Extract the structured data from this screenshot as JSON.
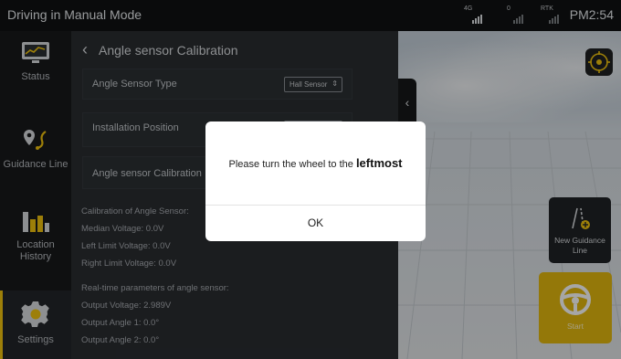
{
  "topbar": {
    "title": "Driving in Manual Mode",
    "signals": [
      {
        "label": "4G"
      },
      {
        "label": "0"
      },
      {
        "label": "RTK"
      }
    ],
    "clock": "PM2:54"
  },
  "sidebar": {
    "items": [
      {
        "label": "Status",
        "icon": "monitor-chart-icon",
        "active": false
      },
      {
        "label": "Guidance Line",
        "icon": "guidance-line-icon",
        "active": false
      },
      {
        "label": "Location History",
        "icon": "bar-chart-icon",
        "active": false
      },
      {
        "label": "Settings",
        "icon": "gear-icon",
        "active": true
      }
    ]
  },
  "panel": {
    "header": "Angle sensor Calibration",
    "rows": [
      {
        "label": "Angle Sensor Type",
        "value": "Hall Sensor"
      },
      {
        "label": "Installation Position",
        "value": ""
      },
      {
        "label": "Angle sensor Calibration",
        "value": ""
      }
    ],
    "calibration": {
      "heading": "Calibration of Angle Sensor:",
      "median": "Median Voltage: 0.0V",
      "left": "Left Limit Voltage: 0.0V",
      "right": "Right Limit Voltage: 0.0V"
    },
    "realtime": {
      "heading": "Real-time parameters of angle sensor:",
      "output_voltage": "Output Voltage: 2.989V",
      "angle1": "Output Angle 1: 0.0°",
      "angle2": "Output Angle 2: 0.0°"
    }
  },
  "map": {
    "new_guidance_line": "New Guidance Line",
    "start": "Start"
  },
  "dialog": {
    "message_prefix": "Please turn the wheel to the ",
    "message_emphasis": "leftmost",
    "ok": "OK"
  },
  "colors": {
    "accent": "#f1c40f",
    "start_button": "#e4b80f",
    "panel_bg": "#2a2d31",
    "sidebar_bg": "#17191b"
  }
}
